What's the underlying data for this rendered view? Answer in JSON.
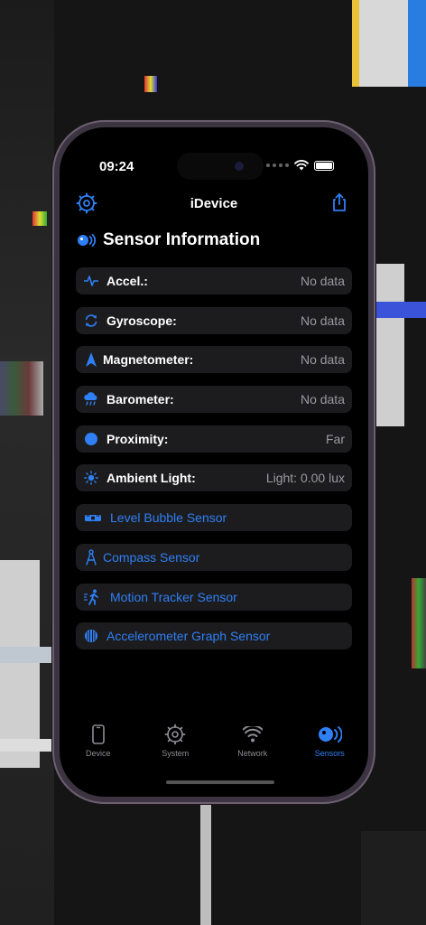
{
  "status_bar": {
    "time": "09:24"
  },
  "nav": {
    "title": "iDevice"
  },
  "section": {
    "title": "Sensor Information"
  },
  "sensors": [
    {
      "label": "Accel.:",
      "value": "No data",
      "icon": "waveform-icon"
    },
    {
      "label": "Gyroscope:",
      "value": "No data",
      "icon": "rotate-icon"
    },
    {
      "label": "Magnetometer:",
      "value": "No data",
      "icon": "location-arrow-icon"
    },
    {
      "label": "Barometer:",
      "value": "No data",
      "icon": "cloud-rain-icon"
    },
    {
      "label": "Proximity:",
      "value": "Far",
      "icon": "circle-icon"
    },
    {
      "label": "Ambient Light:",
      "value": "Light: 0.00 lux",
      "icon": "sun-icon"
    }
  ],
  "links": [
    {
      "label": "Level Bubble Sensor",
      "icon": "level-icon"
    },
    {
      "label": "Compass Sensor",
      "icon": "compass-icon"
    },
    {
      "label": "Motion Tracker Sensor",
      "icon": "figure-walk-icon"
    },
    {
      "label": "Accelerometer Graph Sensor",
      "icon": "graph-circle-icon"
    }
  ],
  "tabs": [
    {
      "label": "Device",
      "icon": "phone-icon"
    },
    {
      "label": "System",
      "icon": "gear-icon"
    },
    {
      "label": "Network",
      "icon": "wifi-icon"
    },
    {
      "label": "Sensors",
      "icon": "sensor-icon"
    }
  ],
  "colors": {
    "accent": "#2f7ff5",
    "row_bg": "#1c1c1e",
    "secondary_text": "#9a9a9f"
  }
}
